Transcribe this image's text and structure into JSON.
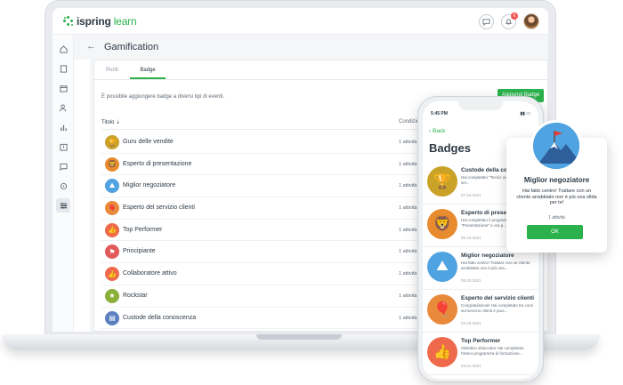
{
  "app": {
    "logo_main": "ispring",
    "logo_accent": "learn",
    "notification_count": "6"
  },
  "page": {
    "title": "Gamification",
    "tabs": [
      {
        "label": "Punti",
        "active": false
      },
      {
        "label": "Badge",
        "active": true
      }
    ],
    "hint": "È possibile aggiungere badge a diversi tipi di eventi.",
    "add_button": "Aggiungi Badge",
    "columns": {
      "title": "Titolo",
      "conditions": "Condizioni"
    },
    "rows": [
      {
        "name": "Guru delle vendite",
        "condition": "1 attività",
        "icon": "trophy-icon",
        "color": "#c9a227"
      },
      {
        "name": "Esperto di presentazione",
        "condition": "1 attività",
        "icon": "lion-icon",
        "color": "#e88a2e"
      },
      {
        "name": "Miglior negoziatore",
        "condition": "1 attività",
        "icon": "mountain-icon",
        "color": "#4fa3e0"
      },
      {
        "name": "Esperto del servizio clienti",
        "condition": "1 attività",
        "icon": "balloon-icon",
        "color": "#e9893a"
      },
      {
        "name": "Top Performer",
        "condition": "1 attività",
        "icon": "thumbs-up-icon",
        "color": "#ef6a4c"
      },
      {
        "name": "Principiante",
        "condition": "1 attività",
        "icon": "flag-icon",
        "color": "#e25a5a"
      },
      {
        "name": "Collaboratore attivo",
        "condition": "1 attività",
        "icon": "thumbs-up-icon",
        "color": "#ef6a4c"
      },
      {
        "name": "Rockstar",
        "condition": "1 attività",
        "icon": "star-icon",
        "color": "#8bb03a"
      },
      {
        "name": "Custode della conoscenza",
        "condition": "1 attività",
        "icon": "book-icon",
        "color": "#5b7fbf"
      }
    ]
  },
  "phone": {
    "time": "5:45 PM",
    "back": "Back",
    "title": "Badges",
    "items": [
      {
        "title": "Custode della co",
        "desc": "Hai completato \"Tecnic ovonzate\" e ora sei...",
        "date": "07.04.2021",
        "icon": "trophy-icon",
        "color": "#c9a227"
      },
      {
        "title": "Esperto di prese",
        "desc": "Hai completato il programma \"Presentazione\" e ora p...",
        "date": "05.23.2021",
        "icon": "lion-icon",
        "color": "#e88a2e"
      },
      {
        "title": "Miglior negoziatore",
        "desc": "Hai fatto centro! Trattare con un cliente arrabbiato non è più una...",
        "date": "05.03.2021",
        "icon": "mountain-icon",
        "color": "#4fa3e0"
      },
      {
        "title": "Esperto del servizio clienti",
        "desc": "Congratulazioni! Hai completato tre corsi sul servizio clienti e puoi...",
        "date": "04.18.2021",
        "icon": "balloon-icon",
        "color": "#e9893a"
      },
      {
        "title": "Top Performer",
        "desc": "Obiettivo sbloccato! Hai completato l'intero programma di formazione...",
        "date": "03.01.2021",
        "icon": "thumbs-up-icon",
        "color": "#ef6a4c"
      }
    ]
  },
  "popup": {
    "title": "Miglior negoziatore",
    "text": "Hai fatto centro! Trattare con un cliente arrabbiato non è più una sfida per te!",
    "count": "1 attività",
    "ok": "OK"
  }
}
